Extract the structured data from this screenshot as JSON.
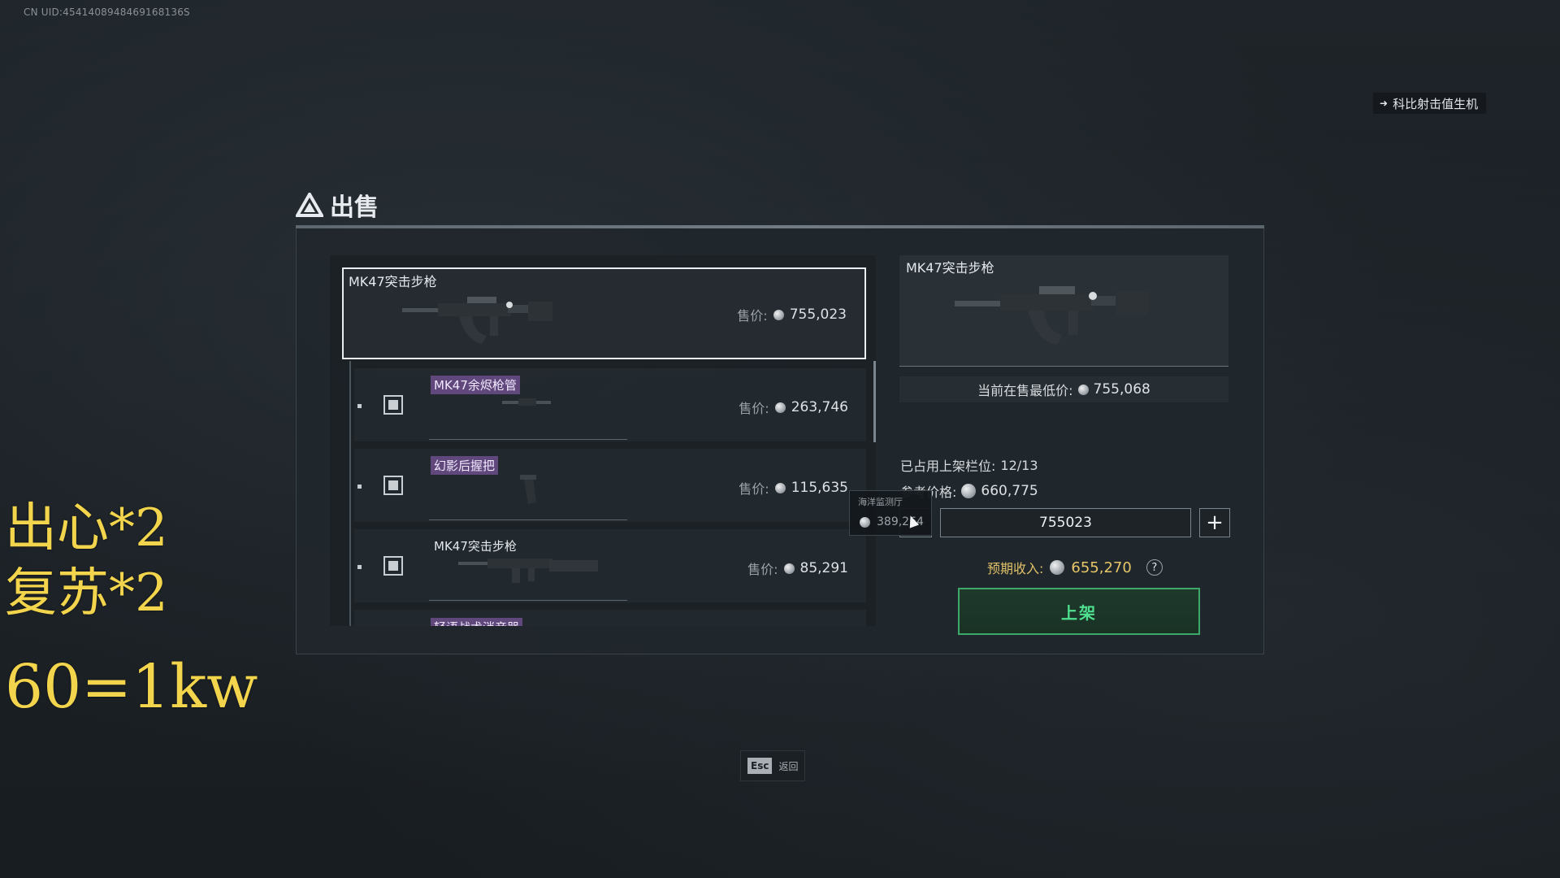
{
  "uid_text": "CN UID:4541408948469168136S",
  "top_right": {
    "label": "科比射击值生机",
    "icon": "back-arrow-icon"
  },
  "overlay": {
    "line1": "出心*2",
    "line2": "复苏*2",
    "line3": "60=1kw"
  },
  "dialog": {
    "title": "出售",
    "title_icon": "triangle-logo-icon"
  },
  "items": {
    "main": {
      "name": "MK47突击步枪",
      "price_label": "售价:",
      "price": "755,023",
      "selected": true
    },
    "subs": [
      {
        "name": "MK47余烬枪管",
        "price_label": "售价:",
        "price": "263,746",
        "tag_style": "purple",
        "checked": true
      },
      {
        "name": "幻影后握把",
        "price_label": "售价:",
        "price": "115,635",
        "tag_style": "purple",
        "checked": true
      },
      {
        "name": "MK47突击步枪",
        "price_label": "售价:",
        "price": "85,291",
        "tag_style": "plain",
        "checked": true
      },
      {
        "name": "轻语战术消音器",
        "tag_style": "purple"
      }
    ]
  },
  "detail": {
    "name": "MK47突击步枪",
    "lowest_label": "当前在售最低价:",
    "lowest_price": "755,068",
    "slots_label": "已占用上架栏位:",
    "slots_value": "12/13",
    "ref_label": "参考价格:",
    "ref_price": "660,775",
    "price_input_value": "755023",
    "minus": "−",
    "plus": "+",
    "income_label": "预期收入:",
    "income_value": "655,270",
    "help": "?",
    "list_button": "上架"
  },
  "tooltip": {
    "title": "海洋监测厅",
    "value": "389,264"
  },
  "footer": {
    "esc_key": "Esc",
    "esc_label": "返回"
  },
  "colors": {
    "accent_green": "#3ea86a",
    "income_gold": "#e7c66a",
    "tag_purple": "#6c4e8a",
    "overlay_yellow": "#f3d54d"
  }
}
